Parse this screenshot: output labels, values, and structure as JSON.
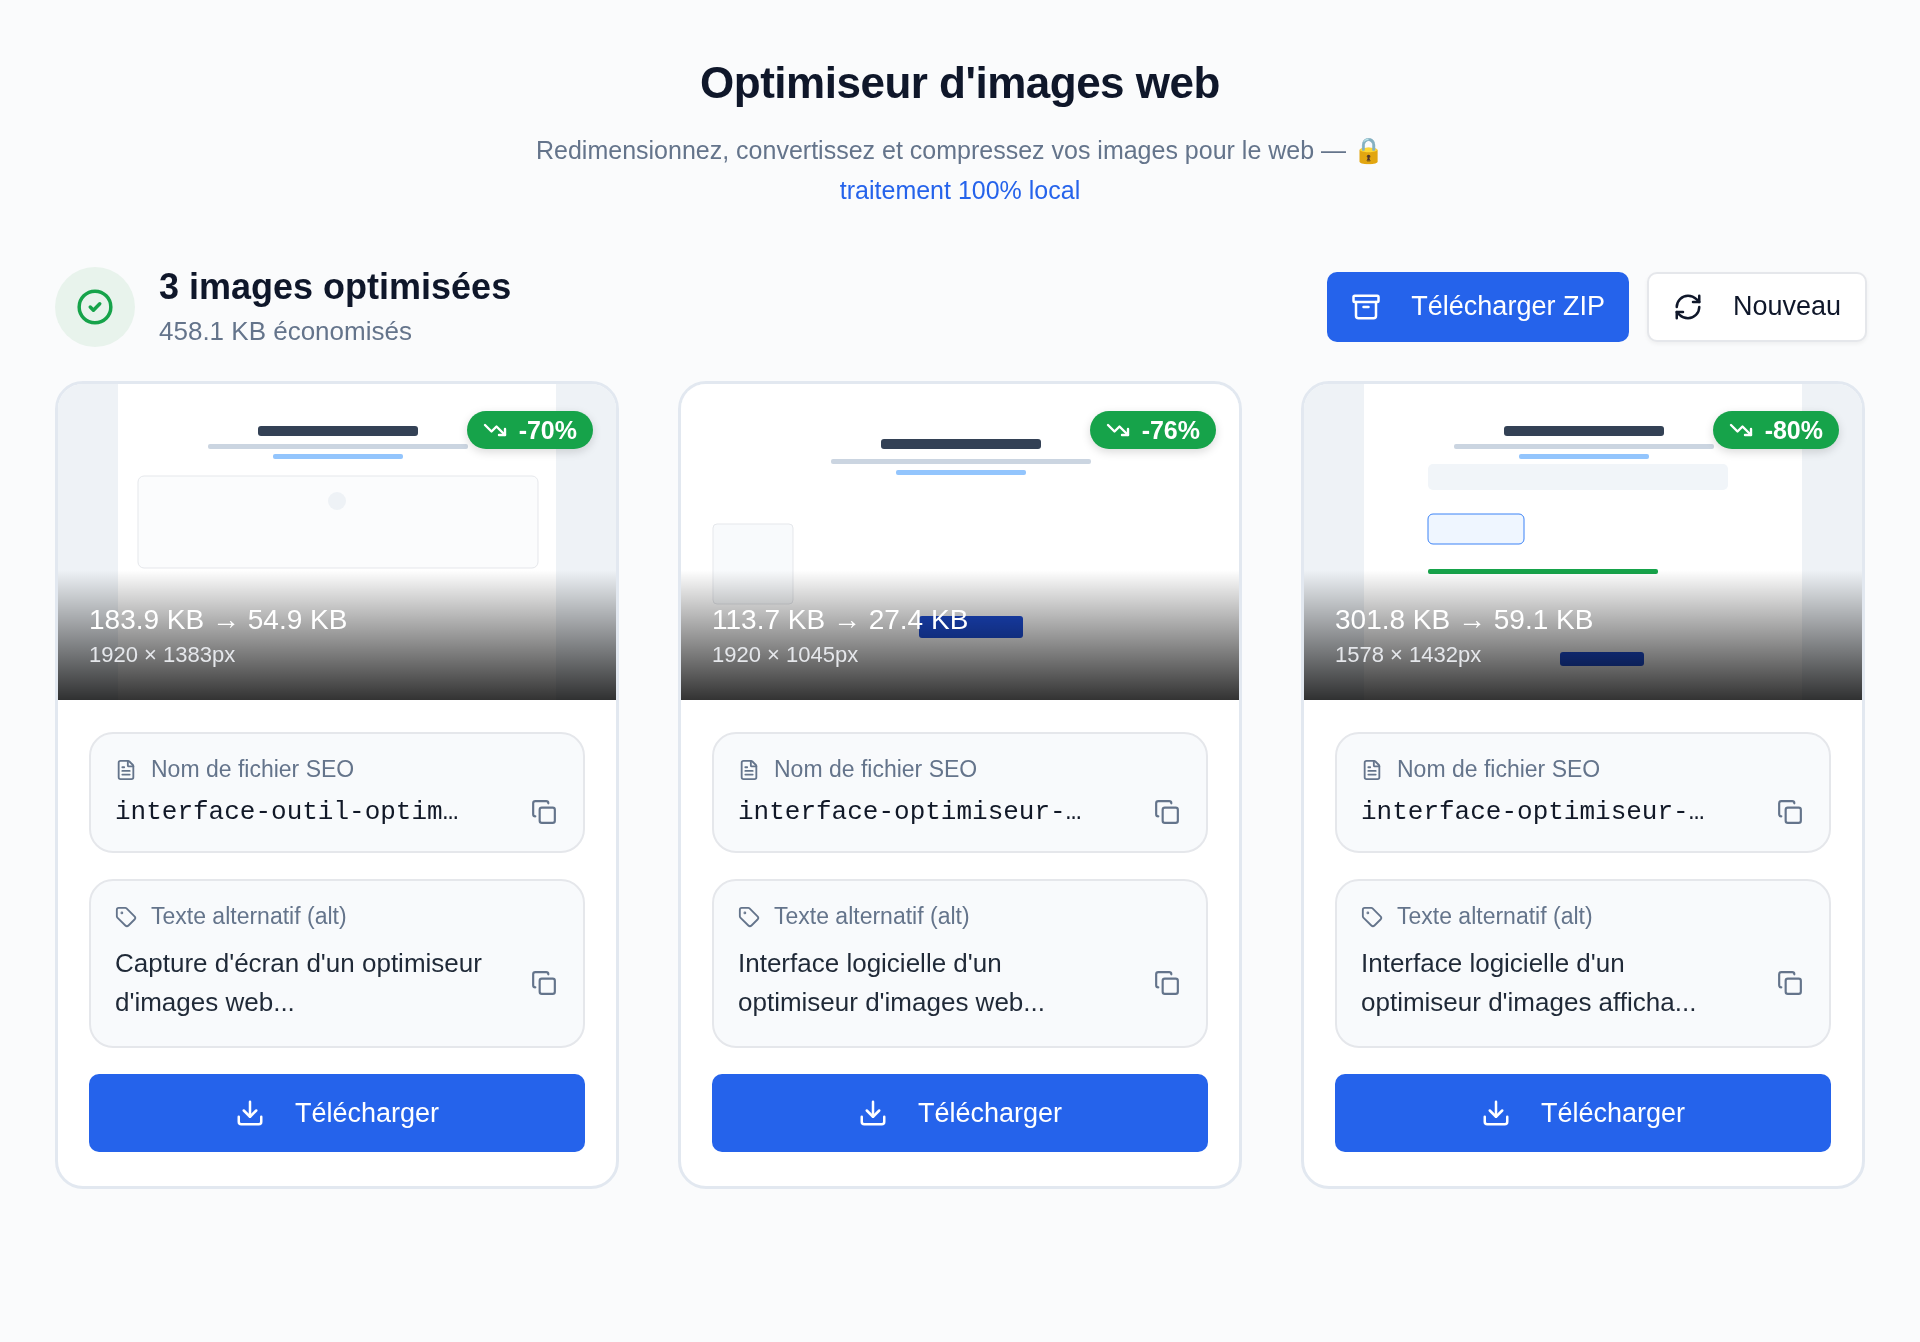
{
  "header": {
    "title": "Optimiseur d'images web",
    "subtitle": "Redimensionnez, convertissez et compressez vos images pour le web — 🔒",
    "subtitle_link": "traitement 100% local"
  },
  "summary": {
    "title": "3 images optimisées",
    "saved": "458.1 KB économisés"
  },
  "actions": [
    {
      "kind": "primary",
      "label": "Télécharger ZIP"
    },
    {
      "kind": "secondary",
      "label": "Nouveau"
    }
  ],
  "results": [
    {
      "reduction": "-70%",
      "sizes": "183.9 KB → 54.9 KB",
      "dimensions": "1920 × 1383px",
      "filename_label": "Nom de fichier SEO",
      "filename": "interface-outil-optim…",
      "alt_label": "Texte alternatif (alt)",
      "alt": "Capture d'écran d'un optimiseur d'images web...",
      "download": "Télécharger"
    },
    {
      "reduction": "-76%",
      "sizes": "113.7 KB → 27.4 KB",
      "dimensions": "1920 × 1045px",
      "filename_label": "Nom de fichier SEO",
      "filename": "interface-optimiseur-…",
      "alt_label": "Texte alternatif (alt)",
      "alt": "Interface logicielle d'un optimiseur d'images web...",
      "download": "Télécharger"
    },
    {
      "reduction": "-80%",
      "sizes": "301.8 KB → 59.1 KB",
      "dimensions": "1578 × 1432px",
      "filename_label": "Nom de fichier SEO",
      "filename": "interface-optimiseur-…",
      "alt_label": "Texte alternatif (alt)",
      "alt": "Interface logicielle d'un optimiseur d'images afficha...",
      "download": "Télécharger"
    }
  ]
}
